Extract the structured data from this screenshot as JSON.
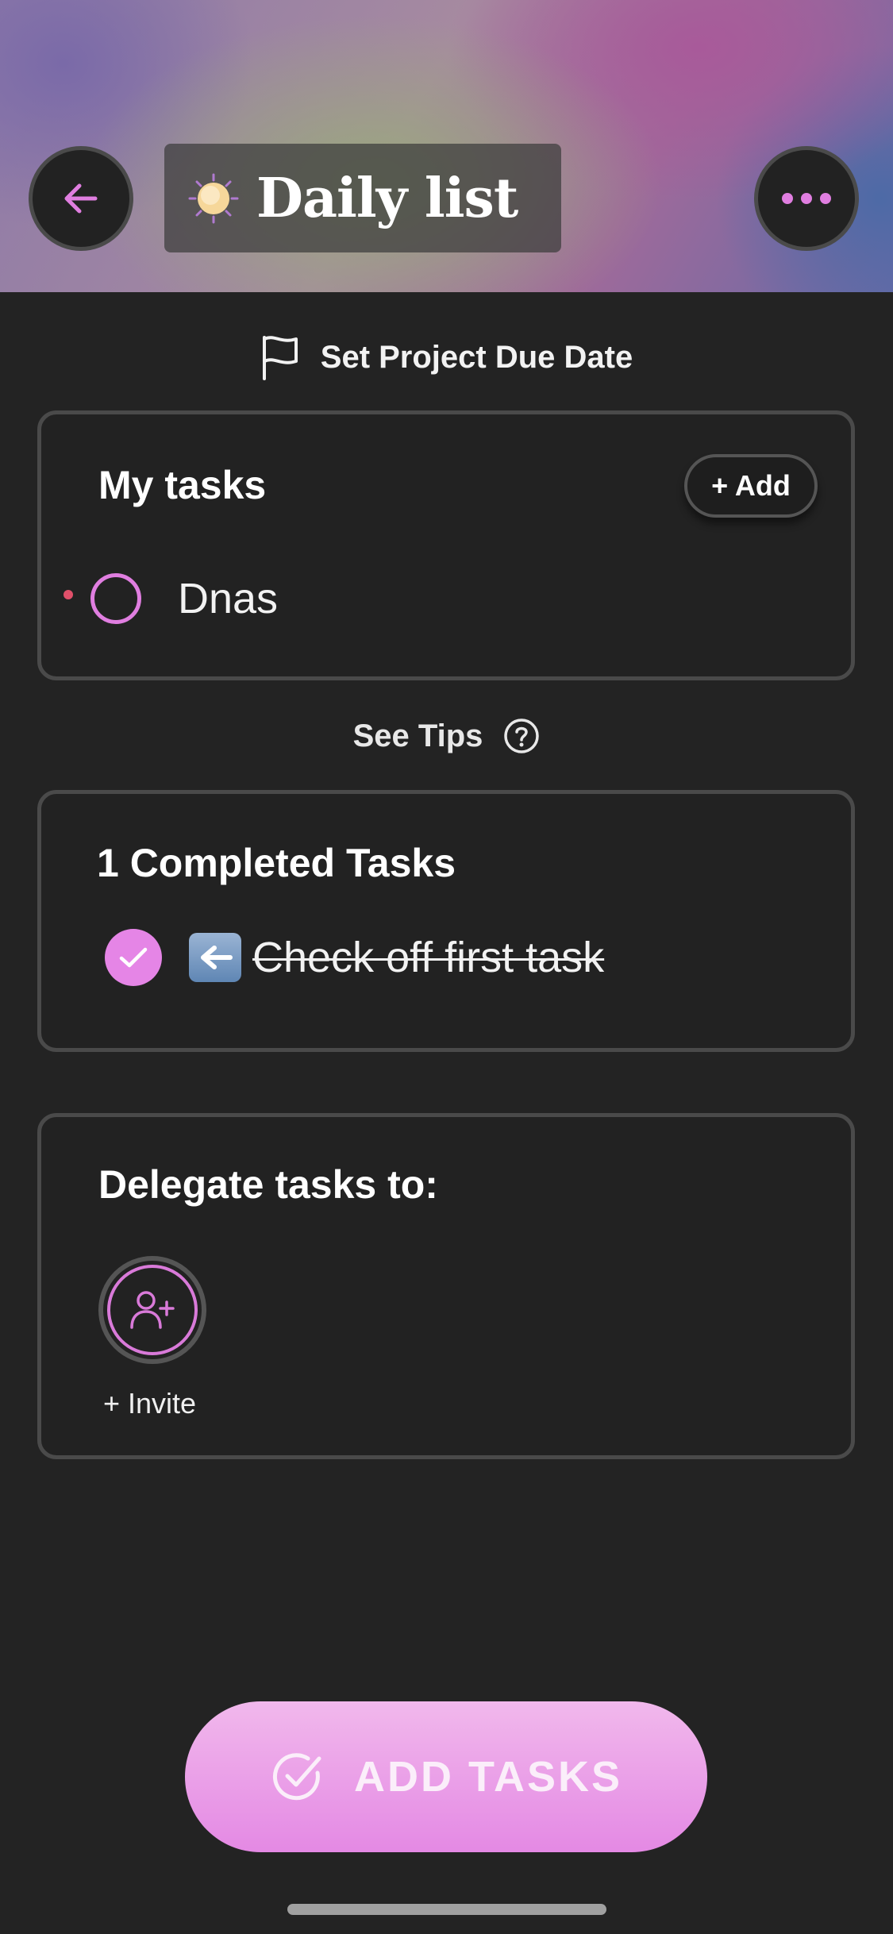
{
  "header": {
    "title": "Daily list",
    "back_icon": "arrow-left-icon",
    "more_icon": "ellipsis-icon",
    "emoji_icon": "sun-emoji-icon"
  },
  "project": {
    "due_date_label": "Set Project Due Date",
    "flag_icon": "flag-icon"
  },
  "my_tasks": {
    "title": "My tasks",
    "add_label": "+ Add",
    "items": [
      {
        "label": "Dnas",
        "completed": false
      }
    ]
  },
  "tips": {
    "label": "See Tips",
    "icon": "help-circle-icon"
  },
  "completed": {
    "title": "1 Completed Tasks",
    "items": [
      {
        "label": "Check off first task",
        "completed": true,
        "emoji": "left-arrow-emoji-icon"
      }
    ]
  },
  "delegate": {
    "title": "Delegate tasks to:",
    "invite_label": "+ Invite",
    "invite_icon": "user-plus-icon"
  },
  "cta": {
    "label": "ADD TASKS",
    "icon": "check-circle-icon"
  },
  "colors": {
    "accent": "#e585e6",
    "background": "#232323",
    "card_border": "#4a4a4a",
    "priority_dot": "#e0506a"
  }
}
